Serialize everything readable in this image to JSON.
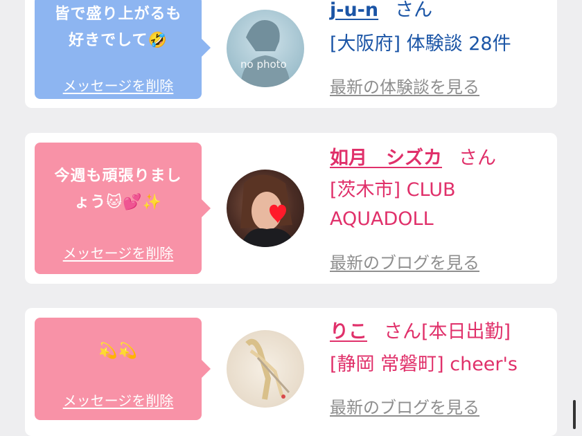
{
  "entries": [
    {
      "message_line1": "皆で盛り上がるも",
      "message_line2": "好きでして🤣",
      "delete_label": "メッセージを削除",
      "avatar_label": "no photo",
      "name": "j-u-n",
      "san": "さん",
      "info_line1": "[大阪府] 体験談 28件",
      "latest_link": "最新の体験談を見る"
    },
    {
      "message_line1": "今週も頑張りまし",
      "message_line2": "ょう🐱💕✨",
      "delete_label": "メッセージを削除",
      "name": "如月　シズカ",
      "san": "さん",
      "info_line1": "[茨木市] CLUB",
      "info_line2": "AQUADOLL",
      "latest_link": "最新のブログを見る"
    },
    {
      "message_line1": "💫💫",
      "delete_label": "メッセージを削除",
      "name": "りこ",
      "san": "さん[本日出勤]",
      "info_line1": "[静岡 常磐町] cheer's",
      "latest_link": "最新のブログを見る"
    }
  ],
  "colors": {
    "blue_bubble": "#8db5f1",
    "pink_bubble": "#f892a7",
    "blue_text": "#1b55a6",
    "pink_text": "#e0306a",
    "link_gray": "#8e8e8e"
  }
}
